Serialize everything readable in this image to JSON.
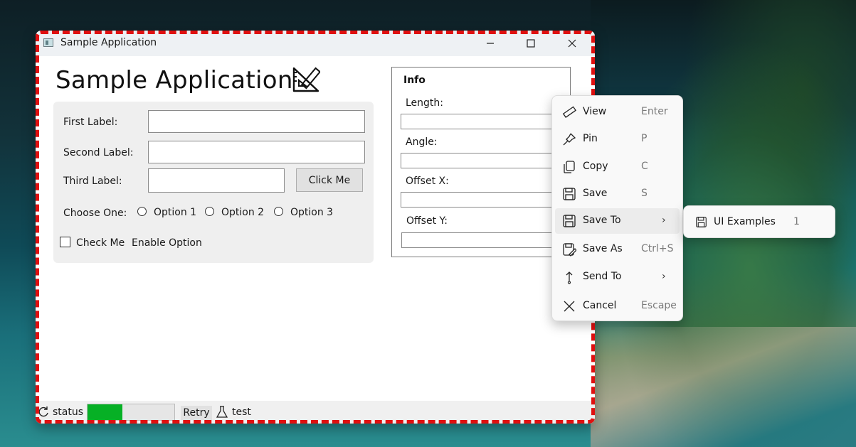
{
  "window": {
    "title": "Sample Application",
    "minimize_glyph": "—",
    "maximize_glyph": "☐",
    "close_glyph": "✕"
  },
  "main": {
    "heading": "Sample Application",
    "heading_icon": "ruler-triangle-icon",
    "form": {
      "first_label": "First Label:",
      "first_value": "",
      "second_label": "Second Label:",
      "second_value": "",
      "third_label": "Third Label:",
      "third_value": "",
      "click_button": "Click Me",
      "choose_label": "Choose One:",
      "options": [
        "Option 1",
        "Option 2",
        "Option 3"
      ],
      "check_label": "Check Me",
      "enable_label": "Enable Option"
    },
    "info": {
      "title": "Info",
      "fields": [
        {
          "label": "Length:",
          "value": ""
        },
        {
          "label": "Angle:",
          "value": ""
        },
        {
          "label": "Offset X:",
          "value": ""
        },
        {
          "label": "Offset Y:",
          "value": ""
        }
      ]
    }
  },
  "statusbar": {
    "status_label": "status",
    "status_icon": "refresh-icon",
    "progress_percent": 40,
    "progress_color": "#06b025",
    "retry_label": "Retry",
    "test_icon": "flask-icon",
    "test_label": "test"
  },
  "context_menu": {
    "items": [
      {
        "label": "View",
        "shortcut": "Enter",
        "icon": "ruler-icon"
      },
      {
        "label": "Pin",
        "shortcut": "P",
        "icon": "pin-icon"
      },
      {
        "label": "Copy",
        "shortcut": "C",
        "icon": "copy-icon"
      },
      {
        "label": "Save",
        "shortcut": "S",
        "icon": "save-icon"
      },
      {
        "label": "Save To",
        "shortcut": "",
        "icon": "save-icon",
        "submenu": true
      },
      {
        "label": "Save As",
        "shortcut": "Ctrl+S",
        "icon": "save-as-icon"
      },
      {
        "label": "Send To",
        "shortcut": "",
        "icon": "send-icon",
        "submenu": true
      },
      {
        "label": "Cancel",
        "shortcut": "Escape",
        "icon": "close-icon"
      }
    ],
    "chevron": "›"
  },
  "submenu": {
    "items": [
      {
        "label": "UI Examples",
        "shortcut": "1",
        "icon": "save-icon"
      }
    ]
  }
}
